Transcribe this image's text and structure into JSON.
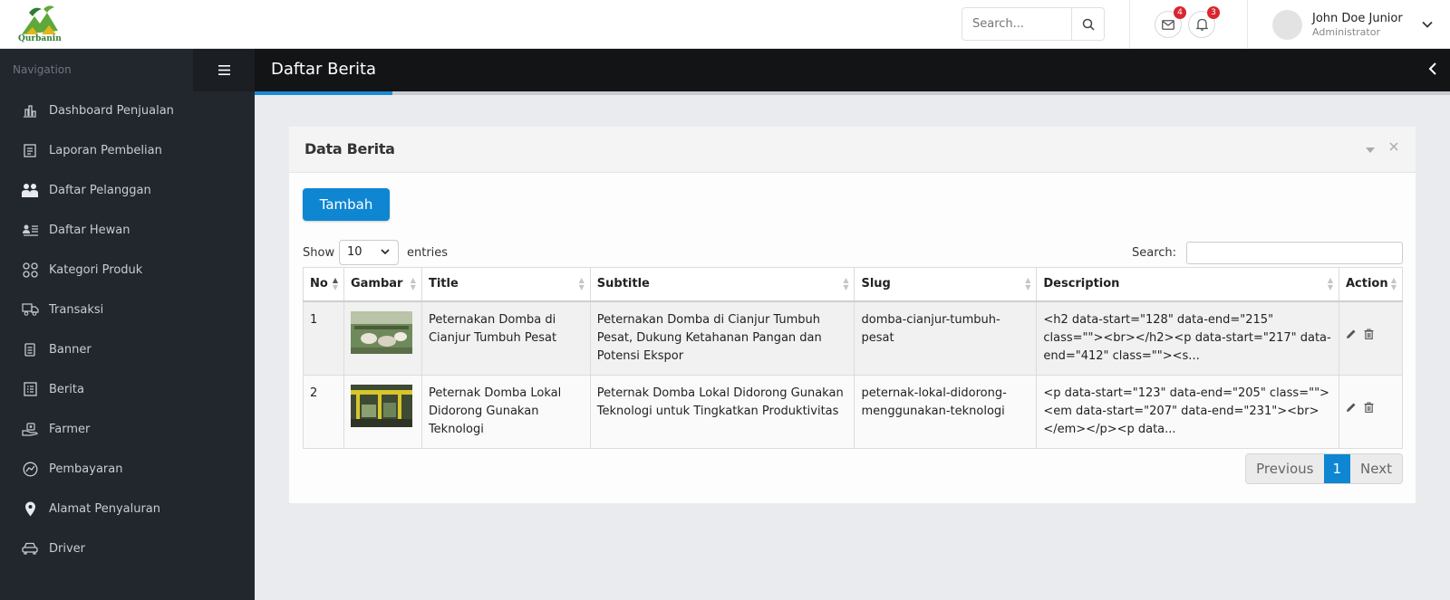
{
  "brand": {
    "name": "Qurbanin"
  },
  "header": {
    "search_placeholder": "Search...",
    "mail_count": "4",
    "notif_count": "3",
    "user_name": "John Doe Junior",
    "user_role": "Administrator"
  },
  "sidebar": {
    "heading": "Navigation",
    "items": [
      {
        "label": "Dashboard Penjualan",
        "icon": "bar-chart-icon"
      },
      {
        "label": "Laporan Pembelian",
        "icon": "list-box-icon"
      },
      {
        "label": "Daftar Pelanggan",
        "icon": "users-icon"
      },
      {
        "label": "Daftar Hewan",
        "icon": "address-list-icon"
      },
      {
        "label": "Kategori Produk",
        "icon": "grid-icon"
      },
      {
        "label": "Transaksi",
        "icon": "truck-icon"
      },
      {
        "label": "Banner",
        "icon": "document-icon"
      },
      {
        "label": "Berita",
        "icon": "news-icon"
      },
      {
        "label": "Farmer",
        "icon": "hand-icon"
      },
      {
        "label": "Pembayaran",
        "icon": "payment-icon"
      },
      {
        "label": "Alamat Penyaluran",
        "icon": "location-pin-icon"
      },
      {
        "label": "Driver",
        "icon": "car-icon"
      }
    ]
  },
  "page": {
    "title": "Daftar Berita",
    "progress": 0.115
  },
  "card": {
    "title": "Data Berita",
    "add_label": "Tambah",
    "show_label": "Show",
    "page_size": "10",
    "entries_label": "entries",
    "search_label": "Search:"
  },
  "table": {
    "columns": [
      "No",
      "Gambar",
      "Title",
      "Subtitle",
      "Slug",
      "Description",
      "Action"
    ],
    "rows": [
      {
        "no": "1",
        "title": "Peternakan Domba di Cianjur Tumbuh Pesat",
        "subtitle": "Peternakan Domba di Cianjur Tumbuh Pesat, Dukung Ketahanan Pangan dan Potensi Ekspor",
        "slug": "domba-cianjur-tumbuh-pesat",
        "description": "<h2 data-start=\"128\" data-end=\"215\" class=\"\"><br></h2><p data-start=\"217\" data-end=\"412\" class=\"\"><s..."
      },
      {
        "no": "2",
        "title": "Peternak Domba Lokal Didorong Gunakan Teknologi",
        "subtitle": "Peternak Domba Lokal Didorong Gunakan Teknologi untuk Tingkatkan Produktivitas",
        "slug": "peternak-lokal-didorong-menggunakan-teknologi",
        "description": "<p data-start=\"123\" data-end=\"205\" class=\"\"><em data-start=\"207\" data-end=\"231\"><br></em></p><p data..."
      }
    ]
  },
  "pagination": {
    "previous": "Previous",
    "current": "1",
    "next": "Next"
  },
  "colors": {
    "accent": "#0f86d2",
    "sidebar": "#22262d",
    "header": "#131416",
    "badge": "#d9262f"
  }
}
